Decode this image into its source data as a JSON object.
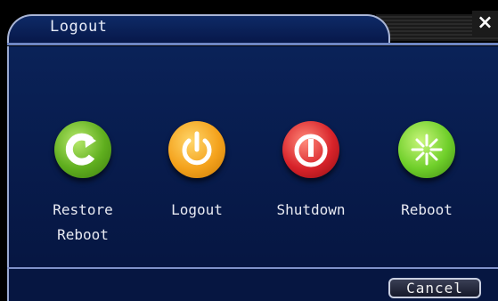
{
  "window": {
    "title": "Logout",
    "close_label": "×"
  },
  "options": [
    {
      "label": "Restore\nReboot",
      "icon": "restore-reboot-icon",
      "color": "#6fbf2a"
    },
    {
      "label": "Logout",
      "icon": "power-icon",
      "color": "#f5a623"
    },
    {
      "label": "Shutdown",
      "icon": "shutdown-icon",
      "color": "#d8232a"
    },
    {
      "label": "Reboot",
      "icon": "reboot-burst-icon",
      "color": "#6fcf2a"
    }
  ],
  "footer": {
    "cancel_label": "Cancel"
  },
  "colors": {
    "panel_bg": "#061642",
    "title_bg": "#0e2a66",
    "accent_line": "#6f87c4"
  }
}
